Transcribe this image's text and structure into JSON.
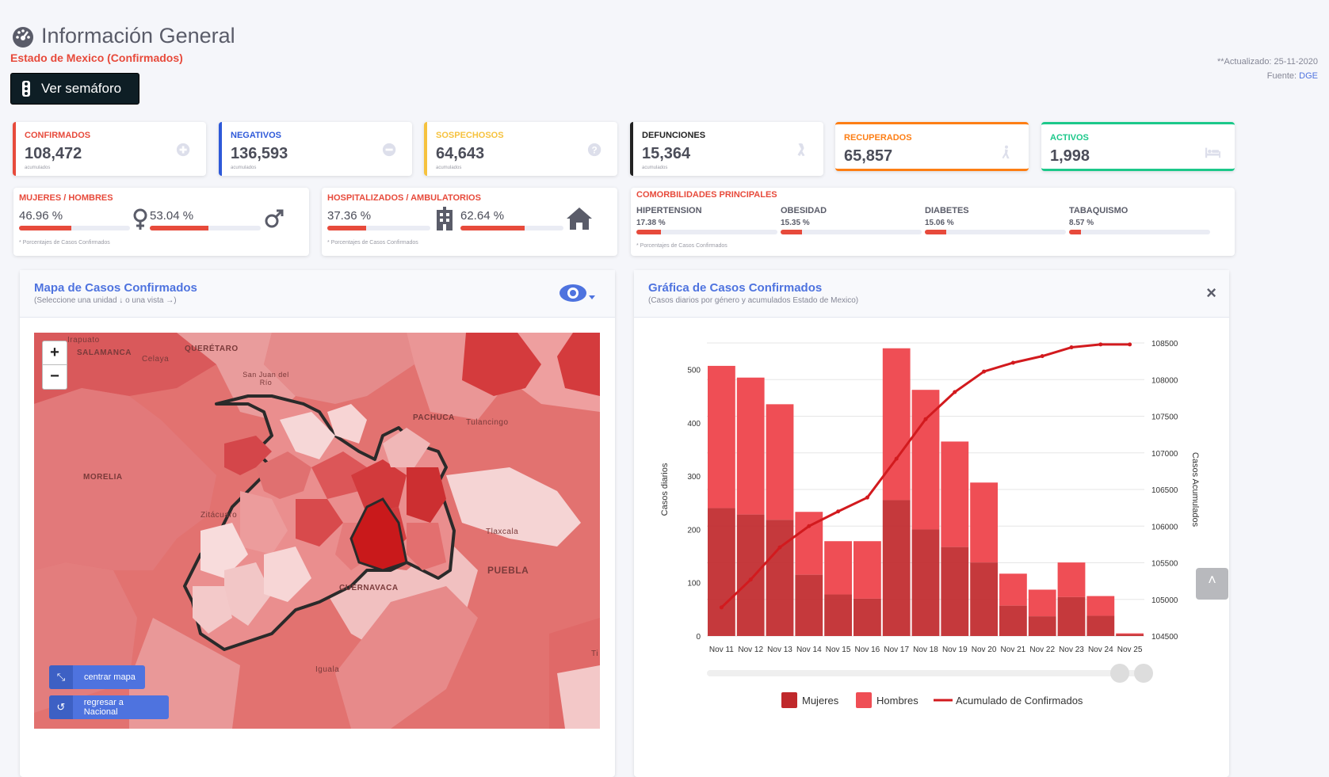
{
  "header": {
    "title": "Información General",
    "subtitle": "Estado de Mexico (Confirmados)",
    "semaforo_button": "Ver semáforo",
    "updated": "**Actualizado: 25-11-2020",
    "source_label": "Fuente:",
    "source_link": "DGE"
  },
  "stats": [
    {
      "label": "CONFIRMADOS",
      "value": "108,472",
      "sub": "acumulados",
      "color": "#e74a3b",
      "icon": "plus-circle-icon"
    },
    {
      "label": "NEGATIVOS",
      "value": "136,593",
      "sub": "acumulados",
      "color": "#2e59d9",
      "icon": "minus-circle-icon"
    },
    {
      "label": "SOSPECHOSOS",
      "value": "64,643",
      "sub": "acumulados",
      "color": "#f6c23e",
      "icon": "question-circle-icon"
    },
    {
      "label": "DEFUNCIONES",
      "value": "15,364",
      "sub": "acumulados",
      "color": "#222222",
      "icon": "ribbon-icon"
    },
    {
      "label": "RECUPERADOS",
      "value": "65,857",
      "sub": "",
      "color": "#fd7e14",
      "icon": "walking-icon"
    },
    {
      "label": "ACTIVOS",
      "value": "1,998",
      "sub": "",
      "color": "#1cc88a",
      "icon": "bed-icon"
    }
  ],
  "gender": {
    "label": "MUJERES / HOMBRES",
    "women_pct": "46.96 %",
    "women_value": 46.96,
    "men_pct": "53.04 %",
    "men_value": 53.04,
    "note": "* Porcentajes  de Casos Confirmados"
  },
  "hospital": {
    "label": "HOSPITALIZADOS / AMBULATORIOS",
    "hosp_pct": "37.36 %",
    "hosp_value": 37.36,
    "amb_pct": "62.64 %",
    "amb_value": 62.64,
    "note": "* Porcentajes  de Casos Confirmados"
  },
  "comorbidities": {
    "label": "COMORBILIDADES PRINCIPALES",
    "note": "* Porcentajes  de Casos Confirmados",
    "items": [
      {
        "name": "HIPERTENSION",
        "pct": "17.38 %",
        "value": 17.38
      },
      {
        "name": "OBESIDAD",
        "pct": "15.35 %",
        "value": 15.35
      },
      {
        "name": "DIABETES",
        "pct": "15.06 %",
        "value": 15.06
      },
      {
        "name": "TABAQUISMO",
        "pct": "8.57 %",
        "value": 8.57
      }
    ]
  },
  "map_panel": {
    "title": "Mapa de Casos Confirmados",
    "subtitle": "(Seleccione una unidad ↓ o una vista →)",
    "zoom_in": "+",
    "zoom_out": "−",
    "center_button": "centrar mapa",
    "national_button": "regresar a Nacional",
    "labels": [
      "Irapuato",
      "SALAMANCA",
      "Celaya",
      "QUERÉTARO",
      "San Juan del Río",
      "PACHUCA",
      "Tulancingo",
      "MORELIA",
      "Zitácuaro",
      "Tlaxcala",
      "PUEBLA",
      "CUERNAVACA",
      "Iguala",
      "Ti"
    ]
  },
  "chart_panel": {
    "title": "Gráfica de Casos Confirmados",
    "subtitle": "(Casos diarios por género y acumulados Estado de Mexico)",
    "close": "×"
  },
  "chart_data": {
    "type": "bar",
    "categories": [
      "Nov 11",
      "Nov 12",
      "Nov 13",
      "Nov 14",
      "Nov 15",
      "Nov 16",
      "Nov 17",
      "Nov 18",
      "Nov 19",
      "Nov 20",
      "Nov 21",
      "Nov 22",
      "Nov 23",
      "Nov 24",
      "Nov 25"
    ],
    "stacked": true,
    "series": [
      {
        "name": "Mujeres",
        "type": "bar",
        "axis": "left",
        "color": "#c0282b",
        "values": [
          240,
          228,
          218,
          115,
          78,
          70,
          255,
          200,
          167,
          138,
          57,
          37,
          73,
          38,
          3
        ]
      },
      {
        "name": "Hombres",
        "type": "bar",
        "axis": "left",
        "color": "#ef4e55",
        "values": [
          267,
          257,
          217,
          118,
          100,
          108,
          285,
          262,
          198,
          150,
          60,
          50,
          65,
          37,
          2
        ]
      },
      {
        "name": "Acumulado de Confirmados",
        "type": "line",
        "axis": "right",
        "color": "#d21a1e",
        "values": [
          104890,
          105270,
          105710,
          106000,
          106200,
          106390,
          106920,
          107460,
          107830,
          108110,
          108230,
          108320,
          108440,
          108480,
          108480
        ]
      }
    ],
    "ylabel": "Casos diarios",
    "ylabel_right": "Casos Acumulados",
    "ylim": [
      0,
      550
    ],
    "yticks": [
      0,
      100,
      200,
      300,
      400,
      500
    ],
    "ylim_right": [
      104500,
      108500
    ],
    "yticks_right": [
      104500,
      105000,
      105500,
      106000,
      106500,
      107000,
      107500,
      108000,
      108500
    ],
    "legend_position": "bottom",
    "grid": true
  }
}
